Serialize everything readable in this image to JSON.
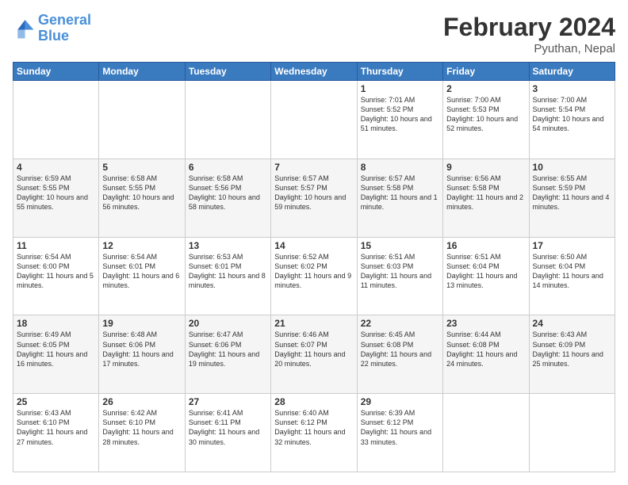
{
  "header": {
    "logo_line1": "General",
    "logo_line2": "Blue",
    "month": "February 2024",
    "location": "Pyuthan, Nepal"
  },
  "weekdays": [
    "Sunday",
    "Monday",
    "Tuesday",
    "Wednesday",
    "Thursday",
    "Friday",
    "Saturday"
  ],
  "weeks": [
    [
      {
        "day": "",
        "sunrise": "",
        "sunset": "",
        "daylight": ""
      },
      {
        "day": "",
        "sunrise": "",
        "sunset": "",
        "daylight": ""
      },
      {
        "day": "",
        "sunrise": "",
        "sunset": "",
        "daylight": ""
      },
      {
        "day": "",
        "sunrise": "",
        "sunset": "",
        "daylight": ""
      },
      {
        "day": "1",
        "sunrise": "Sunrise: 7:01 AM",
        "sunset": "Sunset: 5:52 PM",
        "daylight": "Daylight: 10 hours and 51 minutes."
      },
      {
        "day": "2",
        "sunrise": "Sunrise: 7:00 AM",
        "sunset": "Sunset: 5:53 PM",
        "daylight": "Daylight: 10 hours and 52 minutes."
      },
      {
        "day": "3",
        "sunrise": "Sunrise: 7:00 AM",
        "sunset": "Sunset: 5:54 PM",
        "daylight": "Daylight: 10 hours and 54 minutes."
      }
    ],
    [
      {
        "day": "4",
        "sunrise": "Sunrise: 6:59 AM",
        "sunset": "Sunset: 5:55 PM",
        "daylight": "Daylight: 10 hours and 55 minutes."
      },
      {
        "day": "5",
        "sunrise": "Sunrise: 6:58 AM",
        "sunset": "Sunset: 5:55 PM",
        "daylight": "Daylight: 10 hours and 56 minutes."
      },
      {
        "day": "6",
        "sunrise": "Sunrise: 6:58 AM",
        "sunset": "Sunset: 5:56 PM",
        "daylight": "Daylight: 10 hours and 58 minutes."
      },
      {
        "day": "7",
        "sunrise": "Sunrise: 6:57 AM",
        "sunset": "Sunset: 5:57 PM",
        "daylight": "Daylight: 10 hours and 59 minutes."
      },
      {
        "day": "8",
        "sunrise": "Sunrise: 6:57 AM",
        "sunset": "Sunset: 5:58 PM",
        "daylight": "Daylight: 11 hours and 1 minute."
      },
      {
        "day": "9",
        "sunrise": "Sunrise: 6:56 AM",
        "sunset": "Sunset: 5:58 PM",
        "daylight": "Daylight: 11 hours and 2 minutes."
      },
      {
        "day": "10",
        "sunrise": "Sunrise: 6:55 AM",
        "sunset": "Sunset: 5:59 PM",
        "daylight": "Daylight: 11 hours and 4 minutes."
      }
    ],
    [
      {
        "day": "11",
        "sunrise": "Sunrise: 6:54 AM",
        "sunset": "Sunset: 6:00 PM",
        "daylight": "Daylight: 11 hours and 5 minutes."
      },
      {
        "day": "12",
        "sunrise": "Sunrise: 6:54 AM",
        "sunset": "Sunset: 6:01 PM",
        "daylight": "Daylight: 11 hours and 6 minutes."
      },
      {
        "day": "13",
        "sunrise": "Sunrise: 6:53 AM",
        "sunset": "Sunset: 6:01 PM",
        "daylight": "Daylight: 11 hours and 8 minutes."
      },
      {
        "day": "14",
        "sunrise": "Sunrise: 6:52 AM",
        "sunset": "Sunset: 6:02 PM",
        "daylight": "Daylight: 11 hours and 9 minutes."
      },
      {
        "day": "15",
        "sunrise": "Sunrise: 6:51 AM",
        "sunset": "Sunset: 6:03 PM",
        "daylight": "Daylight: 11 hours and 11 minutes."
      },
      {
        "day": "16",
        "sunrise": "Sunrise: 6:51 AM",
        "sunset": "Sunset: 6:04 PM",
        "daylight": "Daylight: 11 hours and 13 minutes."
      },
      {
        "day": "17",
        "sunrise": "Sunrise: 6:50 AM",
        "sunset": "Sunset: 6:04 PM",
        "daylight": "Daylight: 11 hours and 14 minutes."
      }
    ],
    [
      {
        "day": "18",
        "sunrise": "Sunrise: 6:49 AM",
        "sunset": "Sunset: 6:05 PM",
        "daylight": "Daylight: 11 hours and 16 minutes."
      },
      {
        "day": "19",
        "sunrise": "Sunrise: 6:48 AM",
        "sunset": "Sunset: 6:06 PM",
        "daylight": "Daylight: 11 hours and 17 minutes."
      },
      {
        "day": "20",
        "sunrise": "Sunrise: 6:47 AM",
        "sunset": "Sunset: 6:06 PM",
        "daylight": "Daylight: 11 hours and 19 minutes."
      },
      {
        "day": "21",
        "sunrise": "Sunrise: 6:46 AM",
        "sunset": "Sunset: 6:07 PM",
        "daylight": "Daylight: 11 hours and 20 minutes."
      },
      {
        "day": "22",
        "sunrise": "Sunrise: 6:45 AM",
        "sunset": "Sunset: 6:08 PM",
        "daylight": "Daylight: 11 hours and 22 minutes."
      },
      {
        "day": "23",
        "sunrise": "Sunrise: 6:44 AM",
        "sunset": "Sunset: 6:08 PM",
        "daylight": "Daylight: 11 hours and 24 minutes."
      },
      {
        "day": "24",
        "sunrise": "Sunrise: 6:43 AM",
        "sunset": "Sunset: 6:09 PM",
        "daylight": "Daylight: 11 hours and 25 minutes."
      }
    ],
    [
      {
        "day": "25",
        "sunrise": "Sunrise: 6:43 AM",
        "sunset": "Sunset: 6:10 PM",
        "daylight": "Daylight: 11 hours and 27 minutes."
      },
      {
        "day": "26",
        "sunrise": "Sunrise: 6:42 AM",
        "sunset": "Sunset: 6:10 PM",
        "daylight": "Daylight: 11 hours and 28 minutes."
      },
      {
        "day": "27",
        "sunrise": "Sunrise: 6:41 AM",
        "sunset": "Sunset: 6:11 PM",
        "daylight": "Daylight: 11 hours and 30 minutes."
      },
      {
        "day": "28",
        "sunrise": "Sunrise: 6:40 AM",
        "sunset": "Sunset: 6:12 PM",
        "daylight": "Daylight: 11 hours and 32 minutes."
      },
      {
        "day": "29",
        "sunrise": "Sunrise: 6:39 AM",
        "sunset": "Sunset: 6:12 PM",
        "daylight": "Daylight: 11 hours and 33 minutes."
      },
      {
        "day": "",
        "sunrise": "",
        "sunset": "",
        "daylight": ""
      },
      {
        "day": "",
        "sunrise": "",
        "sunset": "",
        "daylight": ""
      }
    ]
  ]
}
